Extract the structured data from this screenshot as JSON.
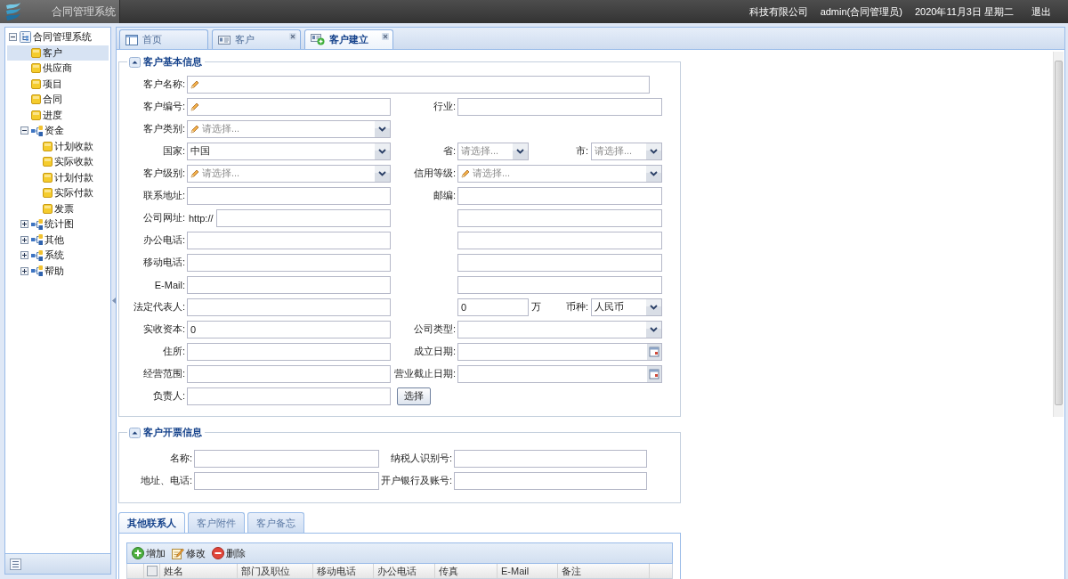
{
  "header": {
    "title": "合同管理系统",
    "company": "科技有限公司",
    "user": "admin(合同管理员)",
    "date": "2020年11月3日 星期二",
    "logout": "退出"
  },
  "sidebar": {
    "tree": [
      {
        "label": "合同管理系统",
        "kind": "root",
        "expanded": true,
        "selected": false,
        "children": [
          {
            "label": "客户",
            "kind": "leaf",
            "selected": true
          },
          {
            "label": "供应商",
            "kind": "leaf",
            "selected": false
          },
          {
            "label": "项目",
            "kind": "leaf",
            "selected": false
          },
          {
            "label": "合同",
            "kind": "leaf",
            "selected": false
          },
          {
            "label": "进度",
            "kind": "leaf",
            "selected": false
          },
          {
            "label": "资金",
            "kind": "folder",
            "expanded": true,
            "selected": false,
            "children": [
              {
                "label": "计划收款",
                "kind": "leaf",
                "selected": false
              },
              {
                "label": "实际收款",
                "kind": "leaf",
                "selected": false
              },
              {
                "label": "计划付款",
                "kind": "leaf",
                "selected": false
              },
              {
                "label": "实际付款",
                "kind": "leaf",
                "selected": false
              },
              {
                "label": "发票",
                "kind": "leaf",
                "selected": false
              }
            ]
          },
          {
            "label": "统计图",
            "kind": "folder",
            "expanded": false,
            "selected": false
          },
          {
            "label": "其他",
            "kind": "folder",
            "expanded": false,
            "selected": false
          },
          {
            "label": "系统",
            "kind": "folder",
            "expanded": false,
            "selected": false
          },
          {
            "label": "帮助",
            "kind": "folder",
            "expanded": false,
            "selected": false
          }
        ]
      }
    ]
  },
  "tabs": [
    {
      "label": "首页",
      "kind": "home",
      "closable": false,
      "selected": false
    },
    {
      "label": "客户",
      "kind": "list",
      "closable": true,
      "selected": false
    },
    {
      "label": "客户建立",
      "kind": "add",
      "closable": true,
      "selected": true
    }
  ],
  "sections": [
    {
      "title": "客户基本信息",
      "expanded": true,
      "rows": [
        {
          "kind": "wide",
          "left": [
            {
              "label": "客户名称:",
              "kind": "text",
              "required": true
            }
          ]
        },
        {
          "kind": "pair",
          "left": [
            {
              "label": "客户编号:",
              "kind": "text",
              "required": true
            }
          ],
          "right": [
            {
              "label": "行业:",
              "kind": "text",
              "required": false
            }
          ]
        },
        {
          "kind": "pair",
          "left": [
            {
              "label": "客户类别:",
              "kind": "select",
              "required": true,
              "placeholder": "请选择..."
            }
          ]
        },
        {
          "kind": "pair",
          "left": [
            {
              "label": "国家:",
              "kind": "select",
              "required": false,
              "value": "中国"
            }
          ],
          "right": [
            {
              "label": "省:",
              "kind": "select",
              "required": false,
              "placeholder": "请选择..."
            },
            {
              "label": "市:",
              "kind": "select",
              "required": false,
              "placeholder": "请选择..."
            }
          ]
        },
        {
          "kind": "pair",
          "left": [
            {
              "label": "客户级别:",
              "kind": "select",
              "required": true,
              "placeholder": "请选择..."
            }
          ],
          "right": [
            {
              "label": "信用等级:",
              "kind": "select",
              "required": true,
              "placeholder": "请选择..."
            }
          ]
        },
        {
          "kind": "pair",
          "left": [
            {
              "label": "联系地址:",
              "kind": "text",
              "required": false
            }
          ],
          "right": [
            {
              "label": "邮编:",
              "kind": "text",
              "required": false
            }
          ]
        },
        {
          "kind": "pair",
          "left": [
            {
              "label": "公司网址:",
              "kind": "text",
              "required": false,
              "prefix": "http://"
            }
          ],
          "right": [
            {
              "kind": "text",
              "required": false
            }
          ]
        },
        {
          "kind": "pair",
          "left": [
            {
              "label": "办公电话:",
              "kind": "text",
              "required": false
            }
          ],
          "right": [
            {
              "kind": "text",
              "required": false
            }
          ]
        },
        {
          "kind": "pair",
          "left": [
            {
              "label": "移动电话:",
              "kind": "text",
              "required": false
            }
          ],
          "right": [
            {
              "kind": "text",
              "required": false
            }
          ]
        },
        {
          "kind": "pair",
          "left": [
            {
              "label": "E-Mail:",
              "kind": "text",
              "required": false
            }
          ],
          "right": [
            {
              "kind": "text",
              "required": false
            }
          ]
        },
        {
          "kind": "pair",
          "left": [
            {
              "label": "法定代表人:",
              "kind": "text",
              "required": false
            }
          ],
          "right": [
            {
              "kind": "text",
              "required": false,
              "value": "0",
              "unit": "万"
            },
            {
              "label": "币种:",
              "kind": "select",
              "required": false,
              "value": "人民币"
            }
          ]
        },
        {
          "kind": "pair",
          "left": [
            {
              "label": "实收资本:",
              "kind": "text",
              "required": false,
              "value": "0"
            }
          ],
          "right": [
            {
              "label": "公司类型:",
              "kind": "select",
              "required": false
            }
          ]
        },
        {
          "kind": "pair",
          "left": [
            {
              "label": "住所:",
              "kind": "text",
              "required": false
            }
          ],
          "right": [
            {
              "label": "成立日期:",
              "kind": "date",
              "required": false
            }
          ]
        },
        {
          "kind": "pair",
          "left": [
            {
              "label": "经营范围:",
              "kind": "text",
              "required": false
            }
          ],
          "right": [
            {
              "label": "营业截止日期:",
              "kind": "date",
              "required": false
            }
          ]
        },
        {
          "kind": "pair",
          "left": [
            {
              "label": "负责人:",
              "kind": "text",
              "required": false
            },
            {
              "kind": "button",
              "label": "选择"
            }
          ]
        }
      ]
    },
    {
      "title": "客户开票信息",
      "expanded": true,
      "rows": [
        {
          "kind": "pair",
          "left": [
            {
              "label": "名称:",
              "kind": "text",
              "required": false
            }
          ],
          "right": [
            {
              "label": "纳税人识别号:",
              "kind": "text",
              "required": false
            }
          ]
        },
        {
          "kind": "pair",
          "left": [
            {
              "label": "地址、电话:",
              "kind": "text",
              "required": false
            }
          ],
          "right": [
            {
              "label": "开户银行及账号:",
              "kind": "text",
              "required": false
            }
          ]
        }
      ]
    }
  ],
  "detail_tabs": [
    {
      "label": "其他联系人",
      "selected": true
    },
    {
      "label": "客户附件",
      "selected": false
    },
    {
      "label": "客户备忘",
      "selected": false
    }
  ],
  "toolbar": [
    {
      "label": "增加",
      "kind": "add"
    },
    {
      "label": "修改",
      "kind": "edit"
    },
    {
      "label": "删除",
      "kind": "delete"
    }
  ],
  "grid": {
    "select_all": {
      "checked": false
    },
    "columns": [
      "姓名",
      "部门及职位",
      "移动电话",
      "办公电话",
      "传真",
      "E-Mail",
      "备注"
    ]
  }
}
